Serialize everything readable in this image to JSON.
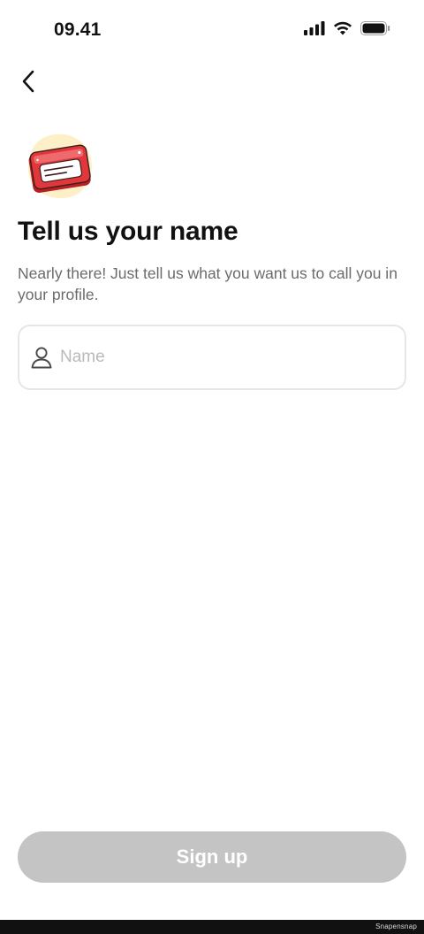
{
  "status_bar": {
    "time": "09.41",
    "icons": [
      "cellular-signal-icon",
      "wifi-icon",
      "battery-icon"
    ]
  },
  "nav": {
    "back_icon": "chevron-left-icon"
  },
  "illustration": {
    "icon": "name-tag-icon",
    "colors": {
      "card": "#e2373a",
      "blob": "#fdf0c8"
    }
  },
  "header": {
    "title": "Tell us your name",
    "subtitle": "Nearly there! Just tell us what you want us to call you in your profile."
  },
  "form": {
    "name_field": {
      "icon": "user-icon",
      "placeholder": "Name",
      "value": ""
    }
  },
  "actions": {
    "signup_label": "Sign up",
    "disabled_color": "#c4c4c4"
  },
  "watermark": "Snapensnap"
}
